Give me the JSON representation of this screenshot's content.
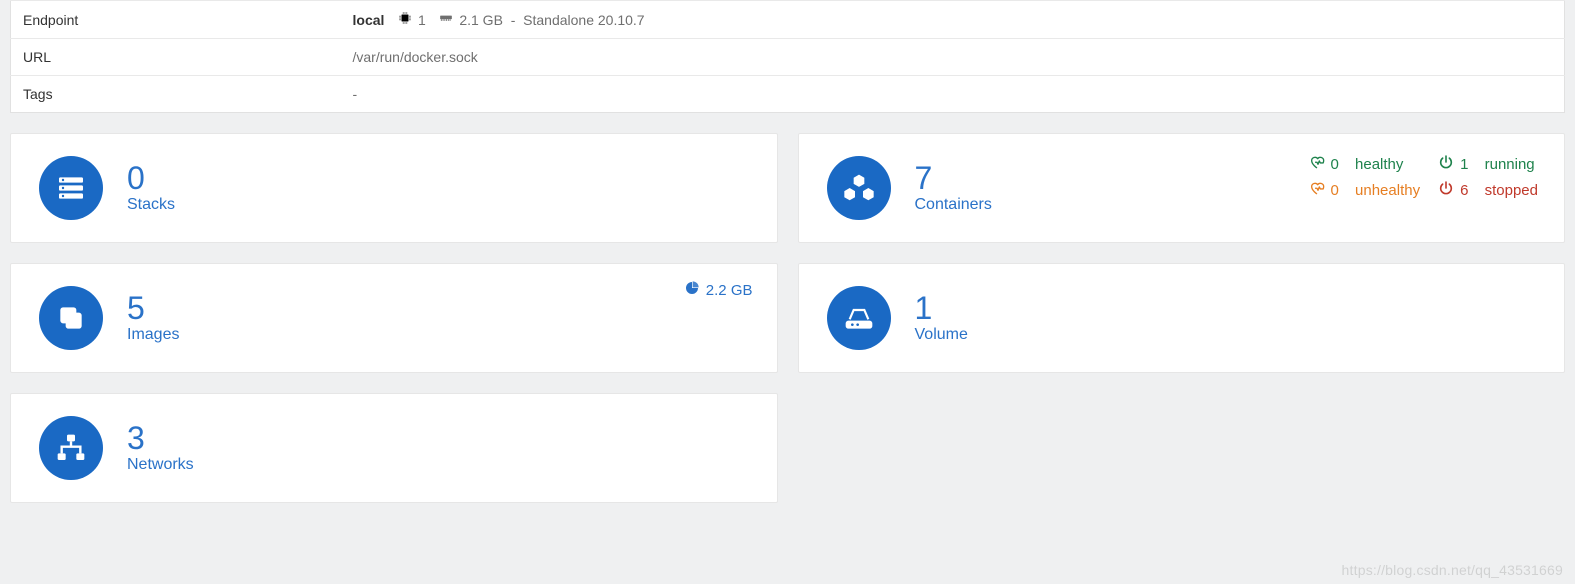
{
  "info": {
    "endpoint_label": "Endpoint",
    "endpoint_name": "local",
    "cpu_count": "1",
    "ram": "2.1 GB",
    "mode": "Standalone 20.10.7",
    "url_label": "URL",
    "url_value": "/var/run/docker.sock",
    "tags_label": "Tags",
    "tags_value": "-"
  },
  "tiles": {
    "stacks": {
      "count": "0",
      "label": "Stacks"
    },
    "containers": {
      "count": "7",
      "label": "Containers",
      "healthy": {
        "n": "0",
        "t": "healthy"
      },
      "running": {
        "n": "1",
        "t": "running"
      },
      "unhealthy": {
        "n": "0",
        "t": "unhealthy"
      },
      "stopped": {
        "n": "6",
        "t": "stopped"
      }
    },
    "images": {
      "count": "5",
      "label": "Images",
      "size": "2.2 GB"
    },
    "volume": {
      "count": "1",
      "label": "Volume"
    },
    "networks": {
      "count": "3",
      "label": "Networks"
    }
  },
  "watermark": "https://blog.csdn.net/qq_43531669"
}
